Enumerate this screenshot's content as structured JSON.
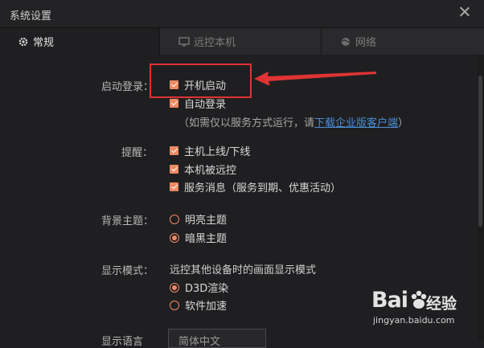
{
  "window": {
    "title": "系统设置"
  },
  "tabs": [
    {
      "label": "常规",
      "icon": "gear-icon",
      "active": true
    },
    {
      "label": "远控本机",
      "icon": "monitor-icon",
      "active": false
    },
    {
      "label": "网络",
      "icon": "globe-icon",
      "active": false
    }
  ],
  "startup": {
    "label": "启动登录：",
    "boot_start": "开机启动",
    "auto_login": "自动登录",
    "note_prefix": "（如需仅以服务方式运行，请",
    "note_link": "下载企业版客户端",
    "note_suffix": "）"
  },
  "reminders": {
    "label": "提醒：",
    "items": [
      "主机上线/下线",
      "本机被远控",
      "服务消息（服务到期、优惠活动）"
    ]
  },
  "theme": {
    "label": "背景主题：",
    "options": [
      "明亮主题",
      "暗黑主题"
    ],
    "selected": "暗黑主题"
  },
  "display": {
    "label": "显示模式：",
    "description": "远控其他设备时的画面显示模式",
    "options": [
      "D3D渲染",
      "软件加速"
    ],
    "selected": "D3D渲染"
  },
  "language": {
    "label": "显示语言",
    "value": "简体中文"
  },
  "watermark": {
    "brand_left": "Bai",
    "brand_right": "经验",
    "url": "jingyan.baidu.com"
  },
  "colors": {
    "accent": "#ee8a62",
    "link": "#4a8fd6",
    "highlight": "#e03333",
    "background": "#1f1f21"
  }
}
